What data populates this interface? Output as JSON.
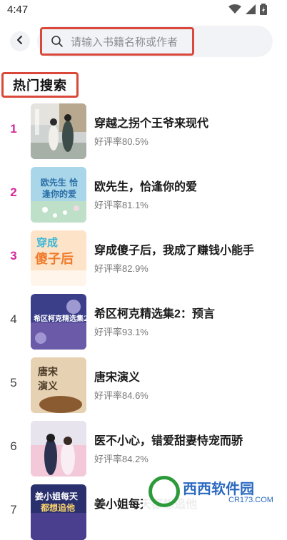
{
  "status_bar": {
    "time": "4:47"
  },
  "search": {
    "placeholder": "请输入书籍名称或作者"
  },
  "section": {
    "title": "热门搜索"
  },
  "books": [
    {
      "rank": "1",
      "title": "穿越之拐个王爷来现代",
      "rating": "好评率80.5%",
      "top": true
    },
    {
      "rank": "2",
      "title": "欧先生，恰逢你的爱",
      "rating": "好评率81.1%",
      "top": true
    },
    {
      "rank": "3",
      "title": "穿成傻子后，我成了赚钱小能手",
      "rating": "好评率82.9%",
      "top": true
    },
    {
      "rank": "4",
      "title": "希区柯克精选集2：预言",
      "rating": "好评率93.1%",
      "top": false
    },
    {
      "rank": "5",
      "title": "唐宋演义",
      "rating": "好评率84.6%",
      "top": false
    },
    {
      "rank": "6",
      "title": "医不小心，错爱甜妻恃宠而骄",
      "rating": "好评率84.2%",
      "top": false
    },
    {
      "rank": "7",
      "title": "姜小姐每天都想追他",
      "rating": "",
      "top": false
    }
  ],
  "covers": {
    "c2": "欧先生 恰逢你的爱",
    "c3a": "穿成",
    "c3b": "傻子后",
    "c4": "希区柯克精选集2",
    "c5a": "唐宋",
    "c5b": "演义",
    "c7a": "姜小姐每天",
    "c7b": "都想追他"
  },
  "watermark": {
    "name": "西西软件园",
    "url": "CR173.COM"
  },
  "colors": {
    "highlight_border": "#d9483b",
    "top_rank": "#d6269a",
    "search_bg": "#f2f3f6"
  }
}
